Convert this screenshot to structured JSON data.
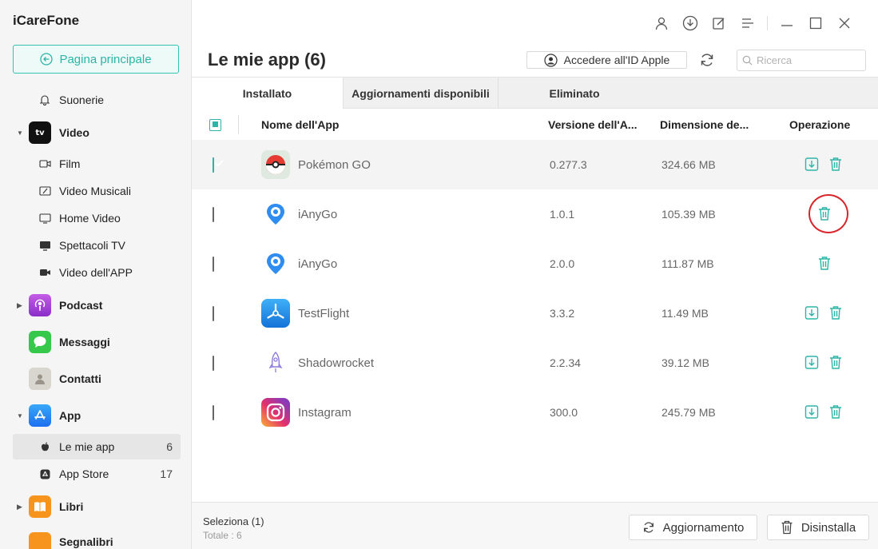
{
  "app": {
    "brand": "iCareFone"
  },
  "sidebar": {
    "home_button": "Pagina principale",
    "items": [
      {
        "label": "Suonerie",
        "icon": "bell-icon"
      },
      {
        "label": "Video",
        "icon": "apple-tv-icon"
      },
      {
        "label": "Film",
        "icon": "film-icon"
      },
      {
        "label": "Video Musicali",
        "icon": "music-video-icon"
      },
      {
        "label": "Home Video",
        "icon": "home-video-icon"
      },
      {
        "label": "Spettacoli TV",
        "icon": "tv-icon"
      },
      {
        "label": "Video dell'APP",
        "icon": "camera-icon"
      },
      {
        "label": "Podcast",
        "icon": "podcast-icon"
      },
      {
        "label": "Messaggi",
        "icon": "messages-icon"
      },
      {
        "label": "Contatti",
        "icon": "contacts-icon"
      },
      {
        "label": "App",
        "icon": "app-store-icon"
      },
      {
        "label": "Le mie app",
        "count": "6",
        "icon": "my-apps-icon"
      },
      {
        "label": "App Store",
        "count": "17",
        "icon": "app-store-small-icon"
      },
      {
        "label": "Libri",
        "icon": "books-icon"
      },
      {
        "label": "Segnalibri",
        "icon": "bookmarks-icon"
      }
    ]
  },
  "header": {
    "title": "Le mie app (6)",
    "apple_id_button": "Accedere all'ID Apple",
    "search_placeholder": "Ricerca"
  },
  "tabs": [
    {
      "label": "Installato",
      "active": true
    },
    {
      "label": "Aggiornamenti disponibili",
      "active": false
    },
    {
      "label": "Eliminato",
      "active": false
    }
  ],
  "table": {
    "columns": [
      "Nome dell'App",
      "Versione dell'A...",
      "Dimensione de...",
      "Operazione"
    ],
    "rows": [
      {
        "name": "Pokémon GO",
        "version": "0.277.3",
        "size": "324.66 MB",
        "checked": true,
        "ops": [
          "download",
          "delete"
        ]
      },
      {
        "name": "iAnyGo",
        "version": "1.0.1",
        "size": "105.39 MB",
        "checked": false,
        "ops": [
          "delete"
        ]
      },
      {
        "name": "iAnyGo",
        "version": "2.0.0",
        "size": "111.87 MB",
        "checked": false,
        "ops": [
          "delete"
        ]
      },
      {
        "name": "TestFlight",
        "version": "3.3.2",
        "size": "11.49 MB",
        "checked": false,
        "ops": [
          "download",
          "delete"
        ]
      },
      {
        "name": "Shadowrocket",
        "version": "2.2.34",
        "size": "39.12 MB",
        "checked": false,
        "ops": [
          "download",
          "delete"
        ]
      },
      {
        "name": "Instagram",
        "version": "300.0",
        "size": "245.79 MB",
        "checked": false,
        "ops": [
          "download",
          "delete"
        ]
      }
    ]
  },
  "footer": {
    "selected": "Seleziona (1)",
    "total": "Totale : 6",
    "update_button": "Aggiornamento",
    "uninstall_button": "Disinstalla"
  },
  "colors": {
    "accent": "#2bb5a6",
    "highlight": "#d9252a"
  }
}
